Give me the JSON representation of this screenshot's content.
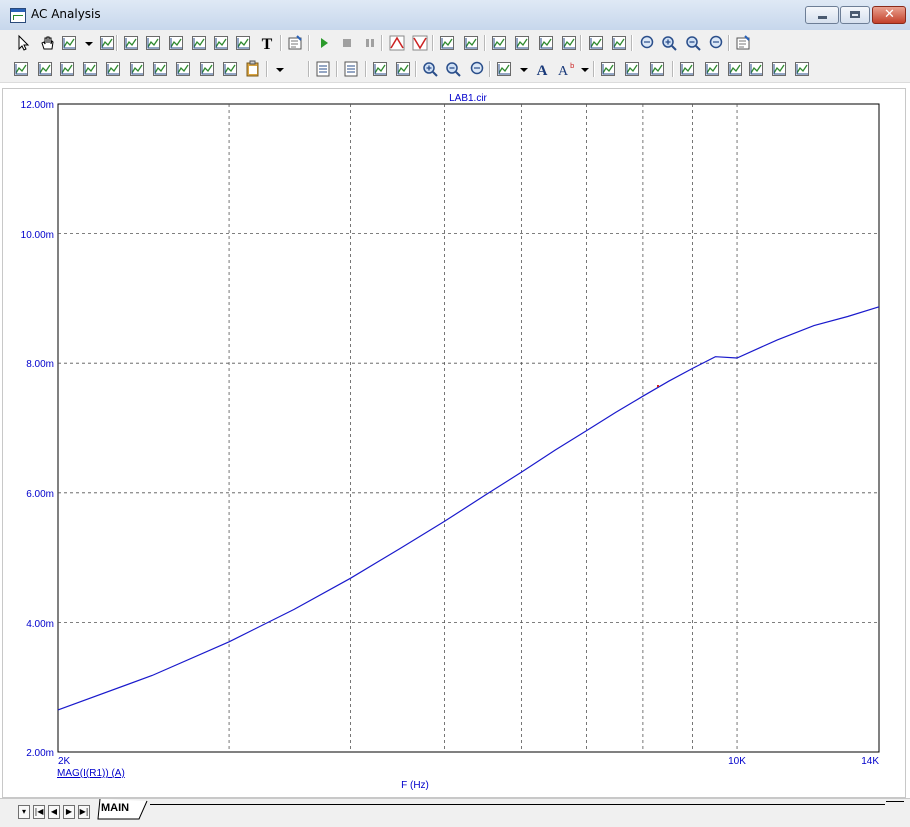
{
  "window": {
    "title": "AC Analysis"
  },
  "toolbar_top": {
    "icons": [
      "select-arrow-icon",
      "pan-hand-icon",
      "scale-icon",
      "dropdown-arrow-icon",
      "picture-icon",
      "plot-zoom-icon",
      "graph-icon",
      "graph-edit-icon",
      "graph-edit2-icon",
      "graph-edit3-icon",
      "formula-icon",
      "text-tool-icon",
      "properties-icon",
      "run-icon",
      "stop-icon",
      "pause-icon",
      "peak-icon",
      "valley-icon",
      "fit-window-icon",
      "grid-icon",
      "grid-lines-icon",
      "grid-fine-icon",
      "grid-bold-icon",
      "grid-box-icon",
      "horizontal-cursor-icon",
      "crosshair-icon",
      "zoom-region-icon",
      "zoom-in-icon",
      "zoom-out-icon",
      "zoom-reset-icon",
      "properties-sheet-icon"
    ]
  },
  "toolbar_bottom": {
    "icons": [
      "cursor-left-icon",
      "cursor-right-icon",
      "peak-find-icon",
      "valley-find-icon",
      "high-find-icon",
      "low-find-icon",
      "slope-icon",
      "inflection-icon",
      "global-high-icon",
      "global-low-icon",
      "clipboard-icon",
      "dropdown-arrow-icon",
      "list-icon",
      "numbers-icon",
      "fit-x-icon",
      "fit-y-icon",
      "zoom-in-icon",
      "zoom-out-icon",
      "zoom-scale-icon",
      "grid-toggle-icon",
      "dropdown-arrow-icon",
      "font-icon",
      "font-style-icon",
      "dropdown-arrow-icon",
      "copy-icon",
      "align-icon",
      "distribute-icon",
      "align-left-icon",
      "align-center-icon",
      "align-right-icon",
      "align-top-icon",
      "align-middle-icon",
      "align-bottom-icon"
    ]
  },
  "plot": {
    "file_label": "LAB1.cir",
    "trace_label": "MAG(I(R1)) (A)",
    "x_axis_label": "F (Hz)",
    "y_ticks": [
      "12.00m",
      "10.00m",
      "8.00m",
      "6.00m",
      "4.00m",
      "2.00m"
    ],
    "x_tick_left": "2K",
    "x_tick_mid": "10K",
    "x_tick_right": "14K",
    "trace_color": "#1a1acc",
    "label_color": "#0000cc"
  },
  "chart_data": {
    "type": "line",
    "x_scale": "log",
    "xlim": [
      2000,
      14000
    ],
    "ylim": [
      0.002,
      0.012
    ],
    "xlabel": "F (Hz)",
    "ylabel": "",
    "series": [
      {
        "name": "MAG(I(R1)) (A)",
        "x": [
          2000,
          2500,
          3000,
          3500,
          4000,
          4500,
          5000,
          5500,
          6000,
          6500,
          7000,
          7500,
          8000,
          8500,
          9000,
          9500,
          10000,
          11000,
          12000,
          13000,
          14000
        ],
        "y": [
          0.00265,
          0.00318,
          0.0037,
          0.0042,
          0.00468,
          0.00514,
          0.00556,
          0.00596,
          0.00632,
          0.00666,
          0.00696,
          0.00724,
          0.00749,
          0.00772,
          0.00792,
          0.0081,
          0.00808,
          0.00836,
          0.00858,
          0.00872,
          0.00887
        ]
      }
    ],
    "grid": true
  },
  "tabs": {
    "active": "MAIN"
  }
}
